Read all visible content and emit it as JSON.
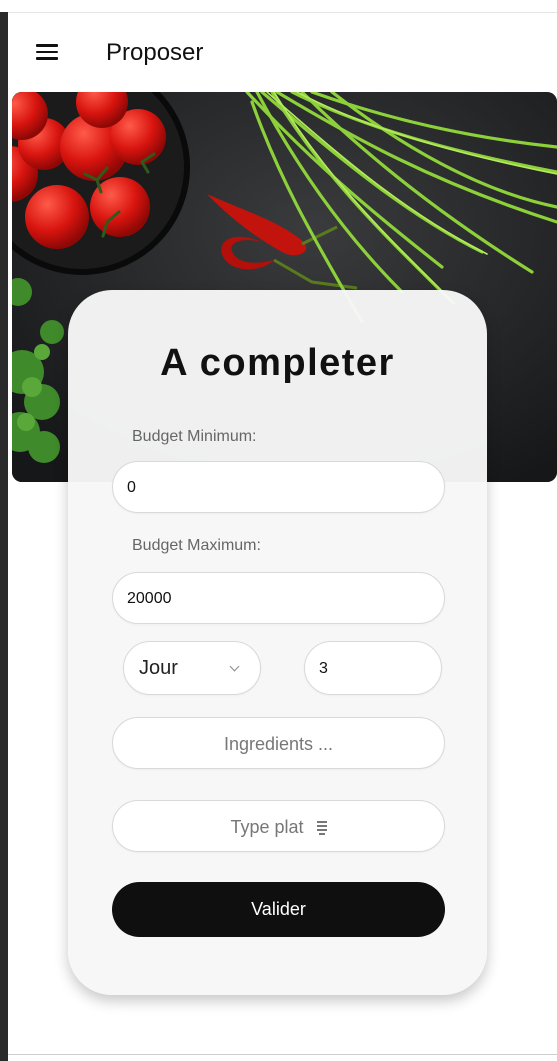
{
  "app_bar": {
    "title": "Proposer",
    "menu_icon": "menu-icon"
  },
  "form": {
    "title": "A completer",
    "budget_min": {
      "label": "Budget Minimum:",
      "value": "0"
    },
    "budget_max": {
      "label": "Budget Maximum:",
      "value": "20000"
    },
    "period": {
      "selected": "Jour",
      "count": "3"
    },
    "ingredients": {
      "placeholder": "Ingredients ..."
    },
    "type_plat": {
      "label": "Type plat",
      "icon": "sort-icon"
    },
    "submit_label": "Valider"
  },
  "colors": {
    "primary": "#0f0f0f",
    "card": "#f7f7f7",
    "hero_bg": "#1e1f21"
  }
}
